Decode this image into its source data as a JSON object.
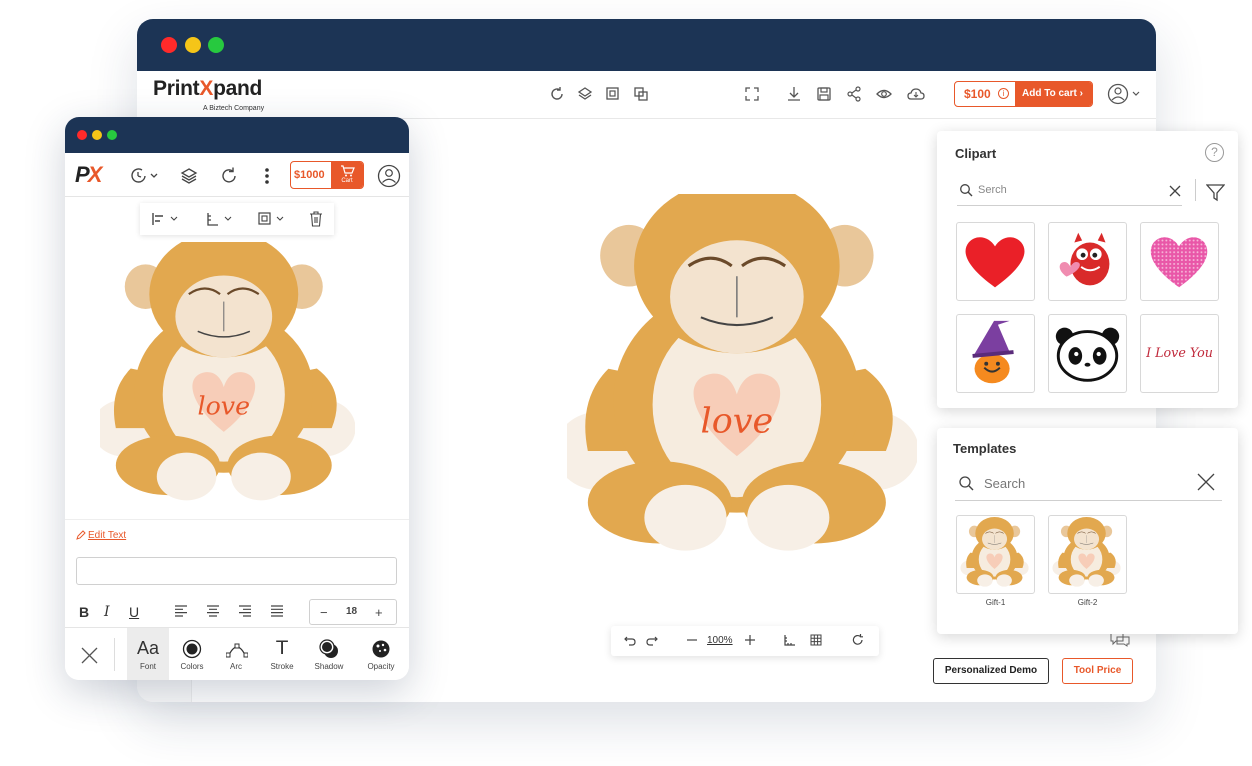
{
  "desktop": {
    "window_dots": [
      "#ff2a2a",
      "#f5c518",
      "#27c93f"
    ],
    "logo": {
      "main_a": "Print",
      "main_x": "X",
      "main_b": "pand",
      "sub": "A Biztech Company"
    },
    "toolbar_icons": [
      "refresh-icon",
      "layers-icon",
      "copy-icon",
      "duplicate-icon",
      "fullscreen-icon",
      "download-icon",
      "save-icon",
      "share-icon",
      "preview-icon",
      "cloud-icon"
    ],
    "price": "$100",
    "info_glyph": "i",
    "add_to_cart": "Add To cart",
    "zoom": "100%",
    "personalized_demo": "Personalized Demo",
    "tool_price": "Tool Price"
  },
  "clipart": {
    "title": "Clipart",
    "help": "?",
    "search_placeholder": "Serch",
    "items": [
      "red-heart",
      "red-monster",
      "pink-dotted-heart",
      "witch-pumpkin",
      "panda-face",
      "i-love-you-text"
    ],
    "love_text": "I Love You"
  },
  "templates": {
    "title": "Templates",
    "search_placeholder": "Search",
    "items": [
      {
        "label": "Gift-1"
      },
      {
        "label": "Gift-2"
      }
    ]
  },
  "mobile": {
    "window_dots": [
      "#ff2a2a",
      "#f5c518",
      "#27c93f"
    ],
    "logo_p": "P",
    "logo_x": "X",
    "price": "$1000",
    "cart_label": "Cart",
    "edit_text": "Edit Text",
    "text_value": "",
    "format": {
      "bold": "B",
      "italic": "I",
      "underline": "U"
    },
    "font_size": "18",
    "minus": "−",
    "plus": "+",
    "tools": [
      {
        "label": "Font",
        "glyph": "Aa"
      },
      {
        "label": "Colors"
      },
      {
        "label": "Arc"
      },
      {
        "label": "Stroke",
        "glyph": "T"
      },
      {
        "label": "Shadow"
      },
      {
        "label": "Opacity"
      }
    ]
  },
  "product": {
    "print_text": "love"
  },
  "colors": {
    "navy": "#1c3455",
    "accent": "#e8582a",
    "plush": "#e2a84f",
    "belly": "#f6ecdf",
    "heart": "#f7cdb8",
    "love": "#e8582a"
  }
}
